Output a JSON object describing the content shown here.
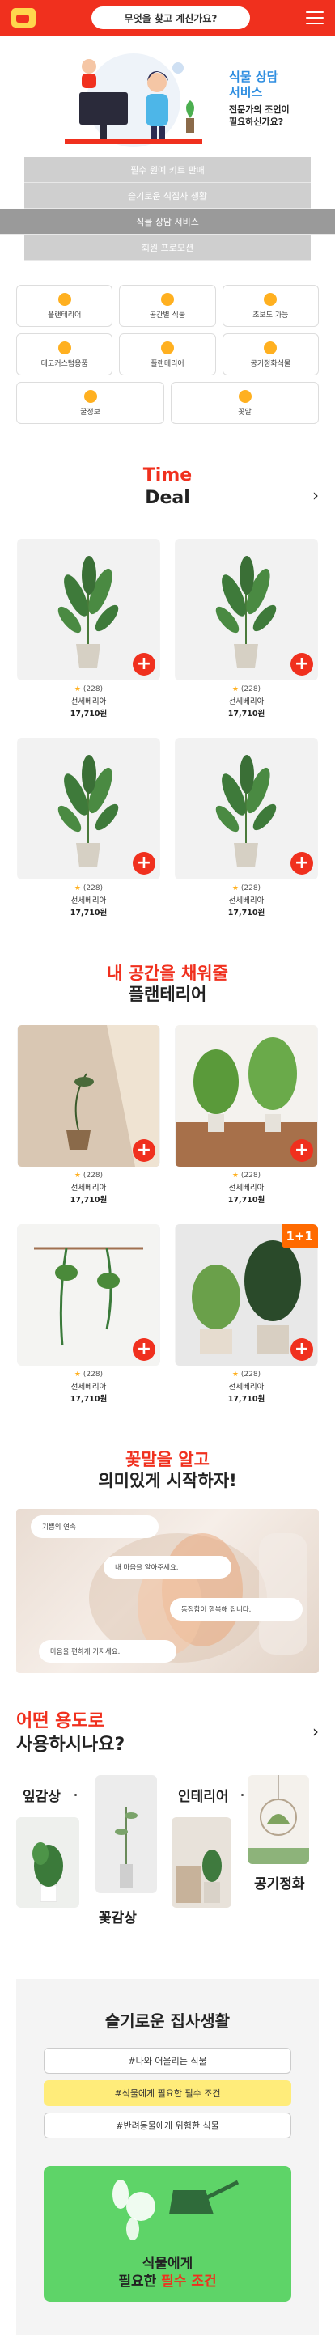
{
  "header": {
    "search_placeholder": "무엇을 찾고 계신가요?"
  },
  "hero": {
    "title_line1": "식물 상담",
    "title_line2": "서비스",
    "sub_line1": "전문가의 조언이",
    "sub_line2": "필요하신가요?"
  },
  "nav": [
    {
      "label": "필수 원예 키트 판매"
    },
    {
      "label": "슬기로운 식집사 생활"
    },
    {
      "label": "식물 상담 서비스"
    },
    {
      "label": "회원 프로모션"
    }
  ],
  "categories": [
    {
      "label": "플랜테리어"
    },
    {
      "label": "공간별 식물"
    },
    {
      "label": "초보도 가능"
    },
    {
      "label": "데코커스텀용품"
    },
    {
      "label": "플랜테리어"
    },
    {
      "label": "공기정화식물"
    }
  ],
  "categories2": [
    {
      "label": "꿀정보"
    },
    {
      "label": "꽃말"
    }
  ],
  "timedeal": {
    "title_red": "Time",
    "title_black": "Deal",
    "arrow": "›"
  },
  "products": [
    {
      "rating": "(228)",
      "name": "선세베리아",
      "price": "17,710원",
      "plus": "+"
    },
    {
      "rating": "(228)",
      "name": "선세베리아",
      "price": "17,710원",
      "plus": "+"
    },
    {
      "rating": "(228)",
      "name": "선세베리아",
      "price": "17,710원",
      "plus": "+"
    },
    {
      "rating": "(228)",
      "name": "선세베리아",
      "price": "17,710원",
      "plus": "+"
    }
  ],
  "planterior": {
    "title_red": "내 공간을 채워줄",
    "title_black": "플랜테리어",
    "badge": "1+1"
  },
  "products2": [
    {
      "rating": "(228)",
      "name": "선세베리아",
      "price": "17,710원",
      "plus": "+"
    },
    {
      "rating": "(228)",
      "name": "선세베리아",
      "price": "17,710원",
      "plus": "+"
    },
    {
      "rating": "(228)",
      "name": "선세베리아",
      "price": "17,710원",
      "plus": "+"
    },
    {
      "rating": "(228)",
      "name": "선세베리아",
      "price": "17,710원",
      "plus": "+"
    }
  ],
  "flower": {
    "title_red": "꽃말을 알고",
    "title_black": "의미있게 시작하자!",
    "bubbles": [
      "기쁨의 연속",
      "내 마음을 알아주세요.",
      "동정함이 행복해 집니다.",
      "마음을 편하게 가지세요."
    ]
  },
  "usage": {
    "title_red": "어떤 용도로",
    "title_black": "사용하시나요?",
    "arrow": "›",
    "labels": [
      "잎감상",
      "꽃감상",
      "인테리어",
      "공기정화"
    ]
  },
  "life": {
    "title": "슬기로운 집사생활",
    "pills": [
      "#나와 어울리는 식물",
      "#식물에게 필요한 필수 조건",
      "#반려동물에게 위험한 식물"
    ],
    "promo_line1": "식물에게",
    "promo_line2a": "필요한 ",
    "promo_line2b": "필수 조건"
  },
  "colors": {
    "brand": "#f0301e",
    "accent_yellow": "#ffec7a",
    "promo_green": "#5ed468",
    "badge": "#ff6a00"
  },
  "icons": [
    "logo-icon",
    "menu-icon",
    "plus-icon",
    "star-icon",
    "chevron-right-icon"
  ]
}
